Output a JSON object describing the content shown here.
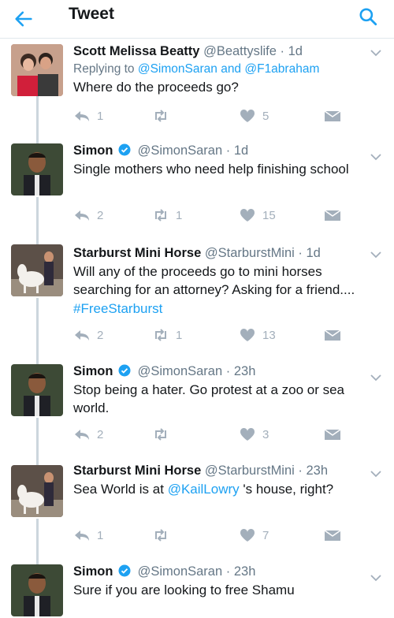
{
  "header": {
    "title": "Tweet"
  },
  "tweets": [
    {
      "name": "Scott Melissa Beatty",
      "handle": "@Beattyslife",
      "time": "· 1d",
      "replying_prefix": "Replying to",
      "replying_users": "@SimonSaran and @F1abraham",
      "text": "Where do the proceeds go?",
      "replies": "1",
      "retweets": "",
      "likes": "5"
    },
    {
      "name": "Simon",
      "handle": "@SimonSaran",
      "time": "· 1d",
      "text": "Single mothers who need help finishing school",
      "replies": "2",
      "retweets": "1",
      "likes": "15"
    },
    {
      "name": "Starburst Mini Horse",
      "handle": "@StarburstMini",
      "time": "· 1d",
      "text": "Will any of the proceeds go to mini horses searching for an attorney? Asking for a friend....",
      "hashtag": "#FreeStarburst",
      "replies": "2",
      "retweets": "1",
      "likes": "13"
    },
    {
      "name": "Simon",
      "handle": "@SimonSaran",
      "time": "· 23h",
      "text": "Stop being a hater. Go protest at a zoo or sea world.",
      "replies": "2",
      "retweets": "",
      "likes": "3"
    },
    {
      "name": "Starburst Mini Horse",
      "handle": "@StarburstMini",
      "time": "· 23h",
      "text_before": "Sea World is at ",
      "mention": "@KailLowry",
      "text_after": " 's house, right?",
      "replies": "1",
      "retweets": "",
      "likes": "7"
    },
    {
      "name": "Simon",
      "handle": "@SimonSaran",
      "time": "· 23h",
      "text": "Sure if you are looking to free Shamu"
    }
  ],
  "colors": {
    "accent": "#1da1f2",
    "muted": "#657786",
    "icon": "#a3afbb",
    "line": "#ccd6dd"
  }
}
